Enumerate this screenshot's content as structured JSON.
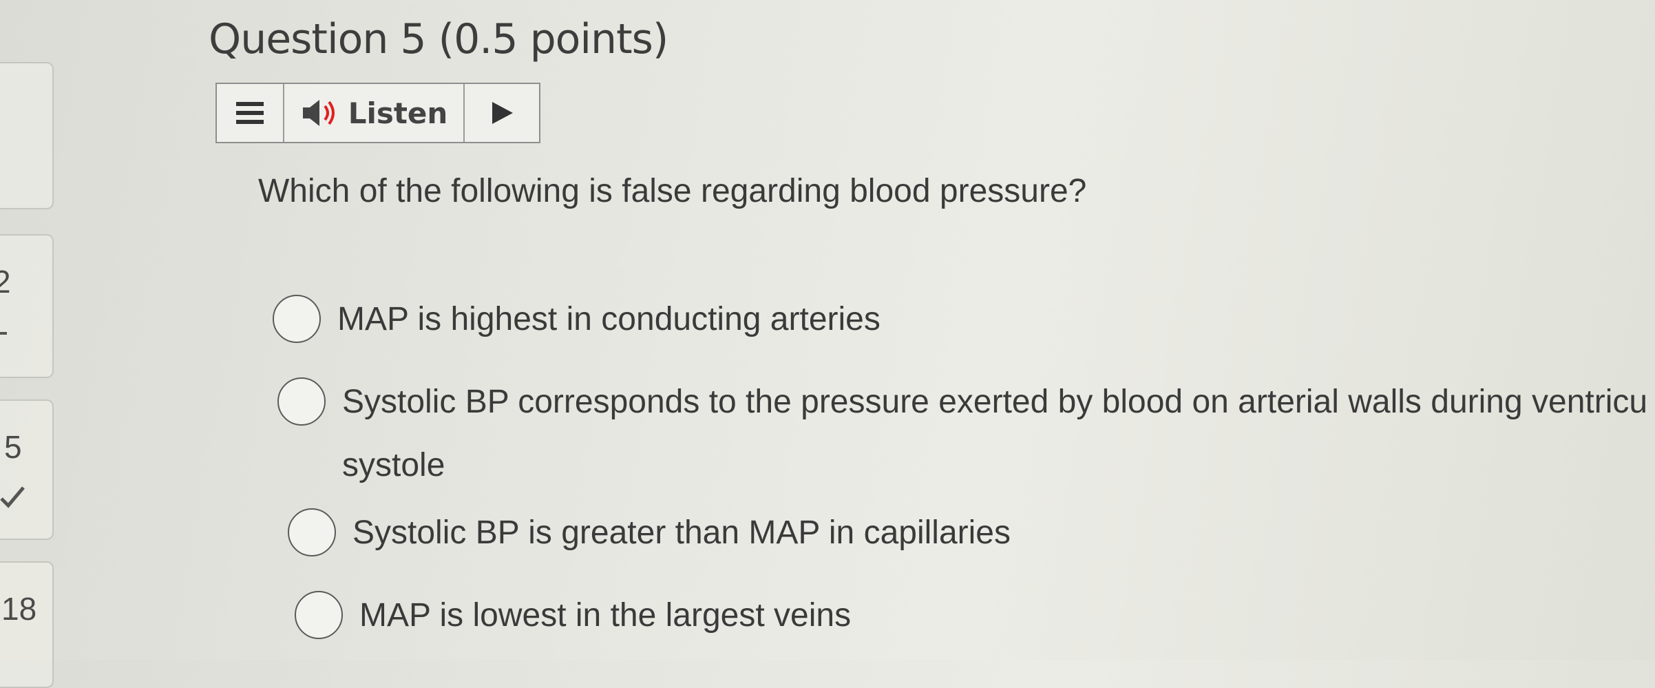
{
  "left_nav": {
    "items": [
      "2",
      "5",
      "18"
    ]
  },
  "question": {
    "title": "Question 5 (0.5 points)",
    "listen_label": "Listen",
    "prompt": "Which of the following is false regarding blood pressure?",
    "options": [
      "MAP is highest in conducting arteries",
      "Systolic BP corresponds to the pressure exerted by blood on arterial walls during ventricu",
      "systole",
      "Systolic BP is greater than MAP in capillaries",
      "MAP is lowest in the largest veins"
    ]
  },
  "icons": [
    "menu-icon",
    "speaker-icon",
    "play-icon",
    "checkmark-icon"
  ],
  "colors": {
    "background": "#e4e4de",
    "text": "#3a3a3a",
    "border": "#8e8e8e"
  }
}
